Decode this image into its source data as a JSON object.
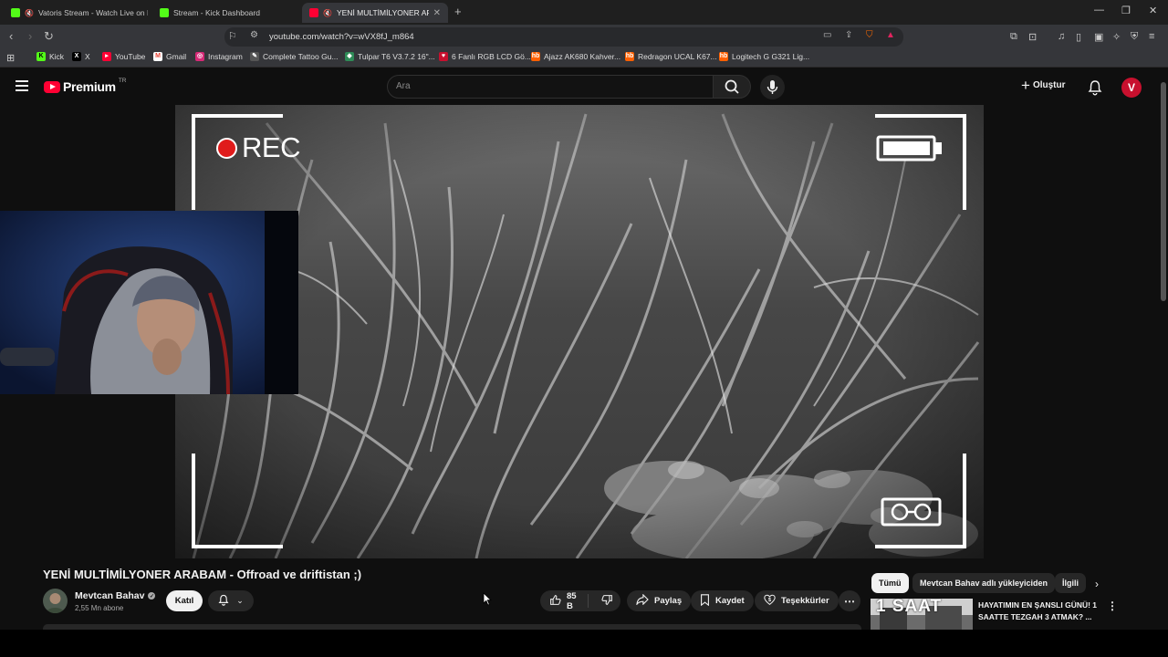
{
  "browser": {
    "tabs": [
      {
        "title": "Vatoris Stream - Watch Live on K",
        "icon": "kick-icon",
        "muted": true,
        "active": false
      },
      {
        "title": "Stream - Kick Dashboard",
        "icon": "kick-icon",
        "muted": false,
        "active": false
      },
      {
        "title": "YENİ MULTİMİLYONER ARABA",
        "icon": "youtube-icon",
        "muted": true,
        "active": true
      }
    ],
    "url": "youtube.com/watch?v=wVX8fJ_m864",
    "bookmarks": [
      {
        "label": "Kick",
        "icon": "kick-icon",
        "color": "#53fc18"
      },
      {
        "label": "X",
        "icon": "x-icon",
        "color": "#000000"
      },
      {
        "label": "YouTube",
        "icon": "youtube-icon",
        "color": "#ff0033"
      },
      {
        "label": "Gmail",
        "icon": "gmail-icon",
        "color": "#ea4335"
      },
      {
        "label": "Instagram",
        "icon": "instagram-icon",
        "color": "#d62976"
      },
      {
        "label": "Complete Tattoo Gu...",
        "icon": "tattoo-icon",
        "color": "#cccccc"
      },
      {
        "label": "Tulpar T6 V3.7.2 16\"...",
        "icon": "tulpar-icon",
        "color": "#2e8b57"
      },
      {
        "label": "6 Fanlı RGB LCD Gö...",
        "icon": "red-icon",
        "color": "#c8102e"
      },
      {
        "label": "Ajazz AK680 Kahver...",
        "icon": "hb-icon",
        "color": "#ff6000"
      },
      {
        "label": "Redragon UCAL K67...",
        "icon": "hb-icon",
        "color": "#ff6000"
      },
      {
        "label": "Logitech G G321 Lig...",
        "icon": "hb-icon",
        "color": "#ff6000"
      }
    ]
  },
  "youtube": {
    "logo_text": "Premium",
    "logo_region": "TR",
    "search_placeholder": "Ara",
    "create_label": "Oluştur",
    "video": {
      "overlay_text": "REC",
      "title": "YENİ MULTİMİLYONER ARABAM - Offroad ve driftistan ;)"
    },
    "channel": {
      "name": "Mevtcan Bahav",
      "subscribers": "2,55 Mn abone",
      "join_label": "Katıl"
    },
    "actions": {
      "likes": "85 B",
      "share": "Paylaş",
      "save": "Kaydet",
      "thanks": "Teşekkürler"
    },
    "chips": [
      "Tümü",
      "Mevtcan Bahav adlı yükleyiciden",
      "İlgili"
    ],
    "recommendation": {
      "thumb_text": "1 SAAT",
      "title": "HAYATIMIN EN ŞANSLI GÜNÜ! 1 SAATTE TEZGAH 3 ATMAK? ..."
    }
  },
  "colors": {
    "accent": "#ff0033",
    "background": "#0f0f0f",
    "rec_dot": "#e01b1b"
  }
}
